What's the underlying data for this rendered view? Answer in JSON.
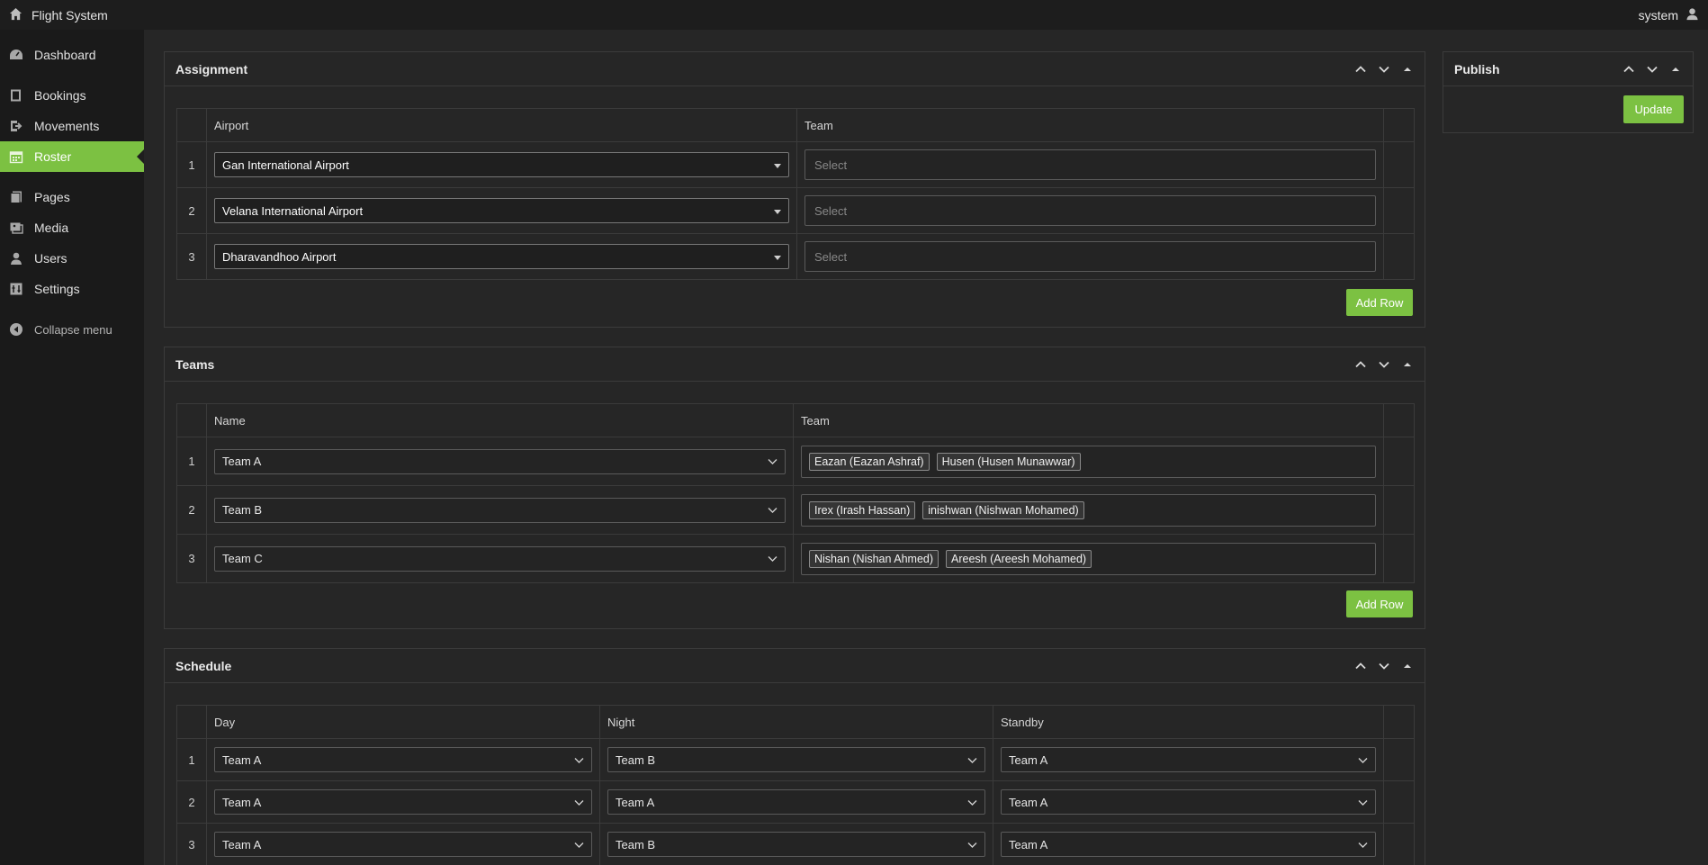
{
  "topbar": {
    "app_title": "Flight System",
    "user_name": "system"
  },
  "sidebar": {
    "items": [
      {
        "label": "Dashboard"
      },
      {
        "label": "Bookings"
      },
      {
        "label": "Movements"
      },
      {
        "label": "Roster"
      },
      {
        "label": "Pages"
      },
      {
        "label": "Media"
      },
      {
        "label": "Users"
      },
      {
        "label": "Settings"
      }
    ],
    "collapse_label": "Collapse menu"
  },
  "assignment": {
    "title": "Assignment",
    "col_airport": "Airport",
    "col_team": "Team",
    "rows": [
      {
        "num": "1",
        "airport": "Gan International Airport",
        "team_placeholder": "Select"
      },
      {
        "num": "2",
        "airport": "Velana International Airport",
        "team_placeholder": "Select"
      },
      {
        "num": "3",
        "airport": "Dharavandhoo Airport",
        "team_placeholder": "Select"
      }
    ],
    "add_row": "Add Row"
  },
  "teams": {
    "title": "Teams",
    "col_name": "Name",
    "col_team": "Team",
    "rows": [
      {
        "num": "1",
        "name": "Team A",
        "members": [
          "Eazan (Eazan Ashraf)",
          "Husen (Husen Munawwar)"
        ]
      },
      {
        "num": "2",
        "name": "Team B",
        "members": [
          "Irex (Irash Hassan)",
          "inishwan (Nishwan Mohamed)"
        ]
      },
      {
        "num": "3",
        "name": "Team C",
        "members": [
          "Nishan (Nishan Ahmed)",
          "Areesh (Areesh Mohamed)"
        ]
      }
    ],
    "add_row": "Add Row"
  },
  "schedule": {
    "title": "Schedule",
    "col_day": "Day",
    "col_night": "Night",
    "col_standby": "Standby",
    "rows": [
      {
        "num": "1",
        "day": "Team A",
        "night": "Team B",
        "standby": "Team A"
      },
      {
        "num": "2",
        "day": "Team A",
        "night": "Team A",
        "standby": "Team A"
      },
      {
        "num": "3",
        "day": "Team A",
        "night": "Team B",
        "standby": "Team A"
      }
    ]
  },
  "publish": {
    "title": "Publish",
    "update_label": "Update"
  },
  "colors": {
    "accent": "#7cc142",
    "background": "#262626",
    "sidebar": "#1a1a1a"
  },
  "icons": [
    "home-icon",
    "user-icon",
    "dashboard-icon",
    "bookings-icon",
    "movements-icon",
    "roster-icon",
    "pages-icon",
    "media-icon",
    "users-icon",
    "settings-icon",
    "collapse-icon",
    "chevron-up-icon",
    "chevron-down-icon",
    "toggle-icon",
    "dropdown-arrow-icon"
  ]
}
